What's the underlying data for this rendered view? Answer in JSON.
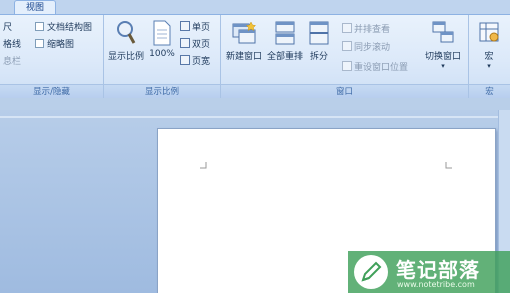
{
  "tab": {
    "label": "视图"
  },
  "show_hide": {
    "items_left": [
      "尺",
      "格线",
      "息栏"
    ],
    "items_right": [
      "文档结构图",
      "缩略图"
    ],
    "group_label": "显示/隐藏"
  },
  "zoom": {
    "zoom_label": "显示比例",
    "percent_label": "100%",
    "single_page": "单页",
    "double_page": "双页",
    "page_width": "页宽",
    "group_label": "显示比例"
  },
  "window": {
    "new_window": "新建窗口",
    "arrange_all": "全部重排",
    "split": "拆分",
    "side_by_side": "并排查看",
    "sync_scroll": "同步滚动",
    "reset_position": "重设窗口位置",
    "switch_window": "切换窗口",
    "group_label": "窗口"
  },
  "macro": {
    "label": "宏",
    "group_label": "宏"
  },
  "watermark": {
    "title": "笔记部落",
    "url": "www.notetribe.com"
  },
  "colors": {
    "ribbon": "#dce9f9",
    "doc_background": "#a9c2e4",
    "watermark": "#40a05a"
  }
}
